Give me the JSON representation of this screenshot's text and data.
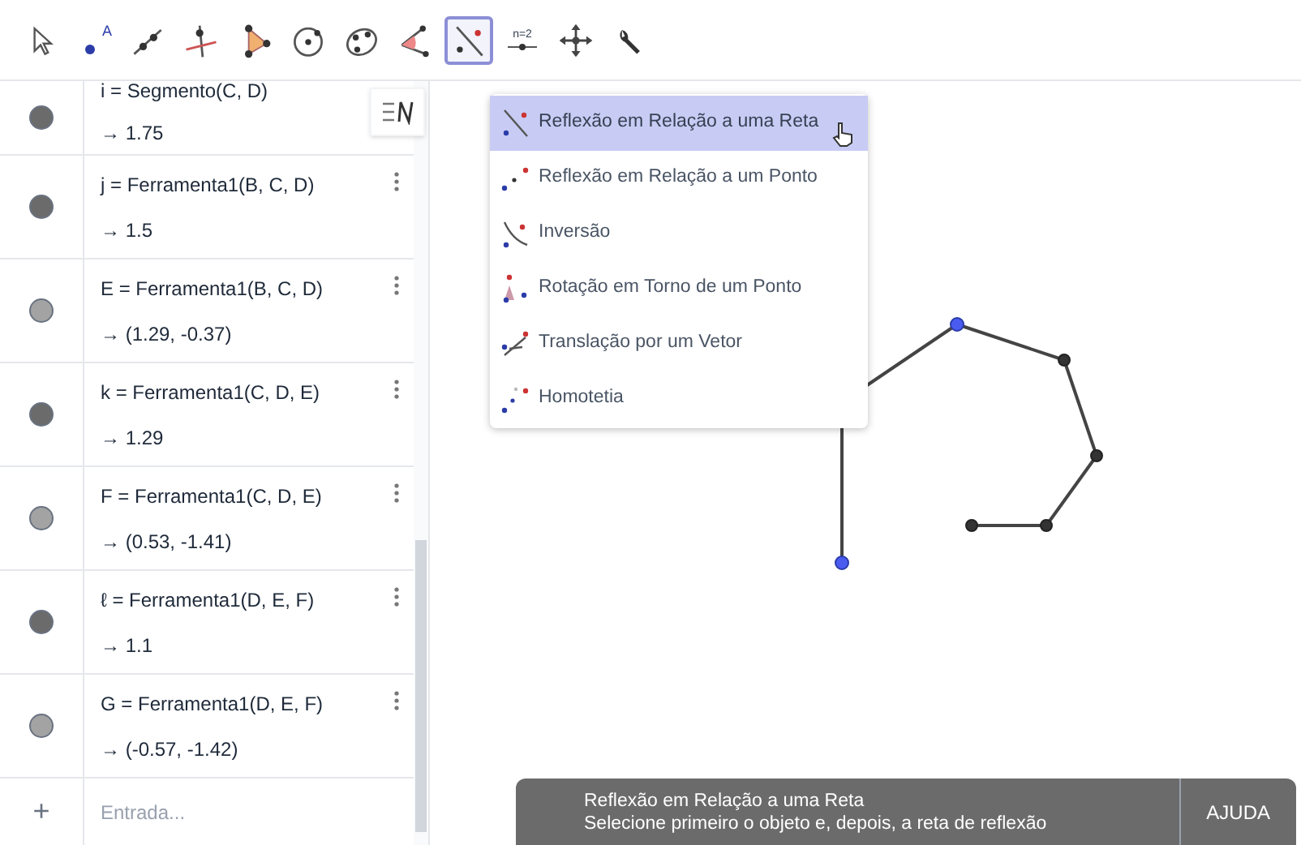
{
  "toolbar": {
    "tools": [
      {
        "kind": "move",
        "selected": false
      },
      {
        "kind": "point",
        "selected": false,
        "label": "A"
      },
      {
        "kind": "line",
        "selected": false
      },
      {
        "kind": "perpendicular",
        "selected": false
      },
      {
        "kind": "polygon",
        "selected": false
      },
      {
        "kind": "circle",
        "selected": false
      },
      {
        "kind": "conic",
        "selected": false
      },
      {
        "kind": "angle",
        "selected": false
      },
      {
        "kind": "reflect",
        "selected": true
      },
      {
        "kind": "slider",
        "selected": false,
        "label": "n=2"
      },
      {
        "kind": "pan",
        "selected": false
      },
      {
        "kind": "wrench",
        "selected": false
      }
    ]
  },
  "algebra": {
    "rows": [
      {
        "definition": "i = Segmento(C, D)",
        "value": "→ 1.75",
        "color": "#6b6b6b"
      },
      {
        "definition": "j = Ferramenta1(B, C, D)",
        "value": "→ 1.5",
        "color": "#6b6b6b"
      },
      {
        "definition": "E = Ferramenta1(B, C, D)",
        "value": "→ (1.29, -0.37)",
        "color": "#a3a3a3"
      },
      {
        "definition": "k = Ferramenta1(C, D, E)",
        "value": "→ 1.29",
        "color": "#6b6b6b"
      },
      {
        "definition": "F = Ferramenta1(C, D, E)",
        "value": "→ (0.53, -1.41)",
        "color": "#a3a3a3"
      },
      {
        "definition": "ℓ = Ferramenta1(D, E, F)",
        "value": "→ 1.1",
        "color": "#6b6b6b"
      },
      {
        "definition": "G = Ferramenta1(D, E, F)",
        "value": "→ (-0.57, -1.42)",
        "color": "#a3a3a3"
      }
    ],
    "input": {
      "icon": "+",
      "placeholder": "Entrada..."
    }
  },
  "menu": {
    "items": [
      {
        "kind": "reflect-line",
        "label": "Reflexão em Relação a uma Reta",
        "selected": true
      },
      {
        "kind": "reflect-point",
        "label": "Reflexão em Relação a um Ponto",
        "selected": false
      },
      {
        "kind": "inversion",
        "label": "Inversão",
        "selected": false
      },
      {
        "kind": "rotate",
        "label": "Rotação em Torno de um Ponto",
        "selected": false
      },
      {
        "kind": "translate",
        "label": "Translação por um Vetor",
        "selected": false
      },
      {
        "kind": "dilate",
        "label": "Homotetia",
        "selected": false
      }
    ]
  },
  "toast": {
    "title": "Reflexão em Relação a uma Reta",
    "message": "Selecione primeiro o objeto e, depois, a reta de reflexão",
    "button": "AJUDA"
  }
}
